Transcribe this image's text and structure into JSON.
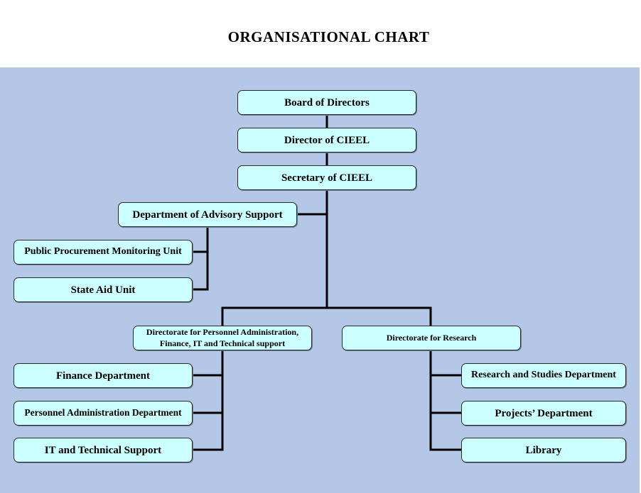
{
  "title": "ORGANISATIONAL CHART",
  "colors": {
    "background": "#b4c7e7",
    "node_fill": "#ccffff",
    "connector": "#000000"
  },
  "nodes": {
    "board": "Board of Directors",
    "director": "Director of CIEEL",
    "secretary": "Secretary of CIEEL",
    "advisory": "Department of Advisory Support",
    "procurement": "Public Procurement Monitoring Unit",
    "state_aid": "State Aid Unit",
    "dir_personnel": "Directorate for Personnel Administration, Finance, IT and Technical support",
    "dir_research": "Directorate for Research",
    "finance": "Finance Department",
    "personnel_admin": "Personnel Administration Department",
    "it_support": "IT and Technical Support",
    "research_studies": "Research and Studies Department",
    "projects": "Projects’ Department",
    "library": "Library"
  },
  "hierarchy": [
    {
      "parent": "board",
      "child": "director"
    },
    {
      "parent": "director",
      "child": "secretary"
    },
    {
      "parent": "secretary",
      "child": "advisory"
    },
    {
      "parent": "secretary",
      "child": "dir_personnel"
    },
    {
      "parent": "secretary",
      "child": "dir_research"
    },
    {
      "parent": "advisory",
      "child": "procurement"
    },
    {
      "parent": "advisory",
      "child": "state_aid"
    },
    {
      "parent": "dir_personnel",
      "child": "finance"
    },
    {
      "parent": "dir_personnel",
      "child": "personnel_admin"
    },
    {
      "parent": "dir_personnel",
      "child": "it_support"
    },
    {
      "parent": "dir_research",
      "child": "research_studies"
    },
    {
      "parent": "dir_research",
      "child": "projects"
    },
    {
      "parent": "dir_research",
      "child": "library"
    }
  ]
}
